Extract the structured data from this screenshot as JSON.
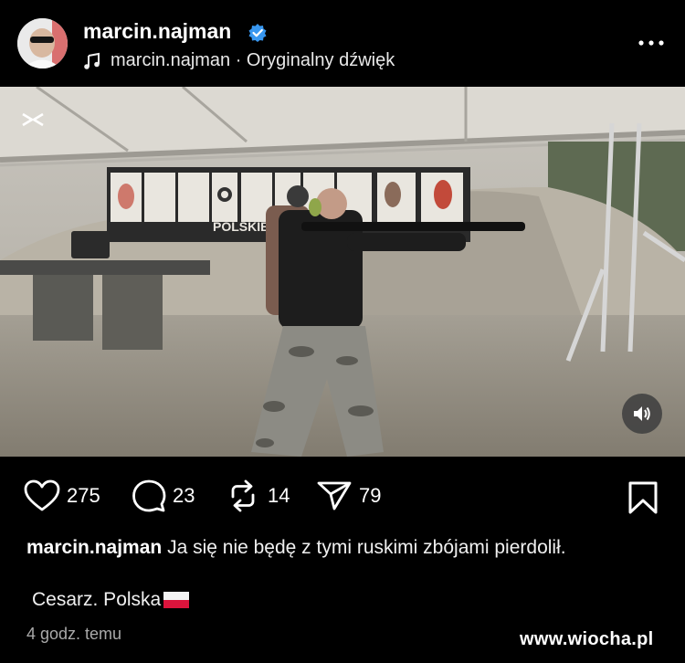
{
  "header": {
    "username": "marcin.najman",
    "audio_label": "marcin.najman · Oryginalny dźwięk",
    "avatar_icon": "profile-avatar",
    "verified_icon": "verified-badge-icon",
    "more_icon": "more-options-icon",
    "verified_color": "#3897f0"
  },
  "media": {
    "overlay_icon": "capcut-logo-icon",
    "banner_text": "POLSKIE",
    "volume_icon": "speaker-icon"
  },
  "actions": {
    "likes": "275",
    "comments": "23",
    "reposts": "14",
    "shares": "79"
  },
  "caption": {
    "username": "marcin.najman",
    "text": "Ja się nie będę z tymi ruskimi zbójami pierdolił.",
    "line2": "Cesarz. Polska",
    "flag": "poland-flag"
  },
  "timestamp": "4 godz. temu",
  "watermark": "www.wiocha.pl"
}
